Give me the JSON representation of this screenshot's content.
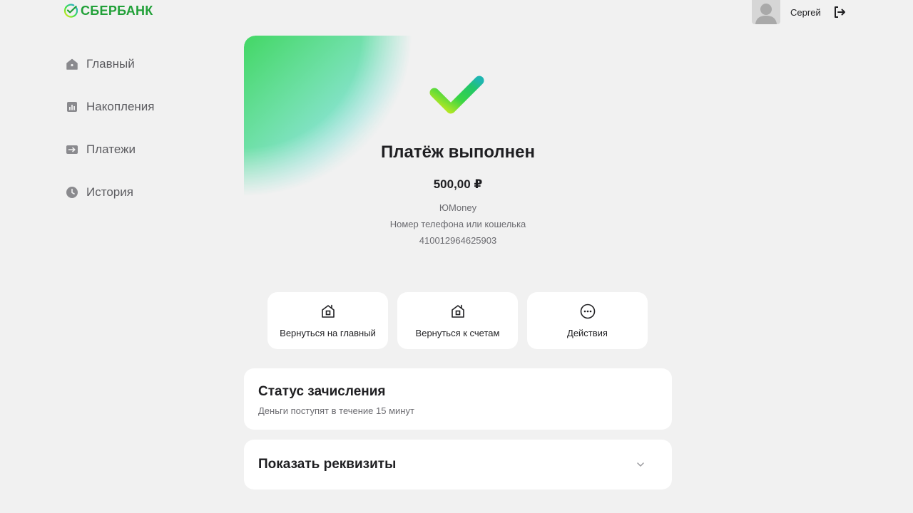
{
  "header": {
    "brand": "СБЕРБАНК",
    "brand_color": "#21a038",
    "user_name": "Сергей",
    "avatar_icon": "user-silhouette-icon",
    "logout_icon": "logout-icon"
  },
  "sidebar": {
    "items": [
      {
        "label": "Главный",
        "icon": "home-icon"
      },
      {
        "label": "Накопления",
        "icon": "chart-icon"
      },
      {
        "label": "Платежи",
        "icon": "transfer-icon"
      },
      {
        "label": "История",
        "icon": "clock-icon"
      }
    ]
  },
  "payment": {
    "title": "Платёж выполнен",
    "amount": "500,00 ₽",
    "recipient": "ЮMoney",
    "field_label": "Номер телефона или кошелька",
    "account": "410012964625903",
    "status_icon": "checkmark-icon"
  },
  "actions": [
    {
      "label": "Вернуться на главный",
      "icon": "home-icon"
    },
    {
      "label": "Вернуться к счетам",
      "icon": "home-icon"
    },
    {
      "label": "Действия",
      "icon": "more-icon"
    }
  ],
  "status_card": {
    "title": "Статус зачисления",
    "subtitle": "Деньги поступят в течение 15 минут"
  },
  "requisites_card": {
    "title": "Показать реквизиты",
    "icon": "chevron-down-icon"
  }
}
